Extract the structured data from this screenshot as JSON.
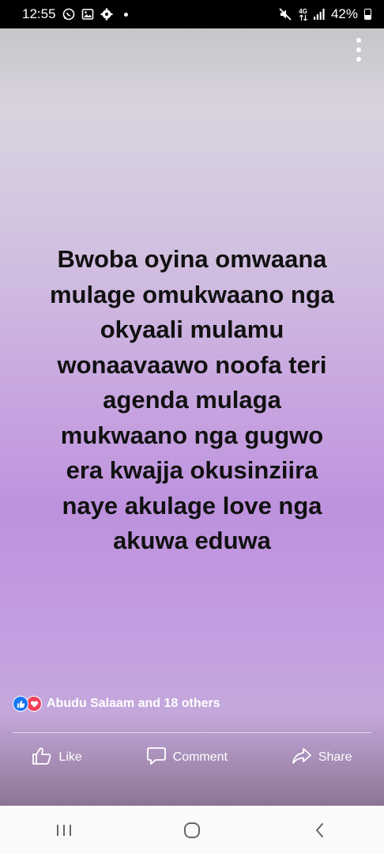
{
  "status_bar": {
    "time": "12:55",
    "network": "4G",
    "battery": "42%",
    "icons": [
      "whatsapp-icon",
      "gallery-icon",
      "settings-icon",
      "notification-dot",
      "mute-icon",
      "network-4g-icon",
      "signal-icon",
      "battery-icon"
    ]
  },
  "post": {
    "text": "Bwoba oyina omwaana\nmulage omukwaano nga\nokyaali mulamu\nwonaavaawo noofa teri\nagenda mulaga\nmukwaano nga gugwo\nera kwajja okusinziira\nnaye akulage love nga\nakuwa eduwa",
    "background": "#c398e0"
  },
  "reactions": {
    "summary": "Abudu Salaam and 18 others",
    "icons": [
      "like-reaction-icon",
      "love-reaction-icon"
    ],
    "like_color": "#1877f2",
    "love_color": "#f33e58"
  },
  "actions": {
    "like_label": "Like",
    "comment_label": "Comment",
    "share_label": "Share"
  },
  "navigation": {
    "icons": [
      "recent-apps-icon",
      "home-icon",
      "back-icon"
    ]
  }
}
